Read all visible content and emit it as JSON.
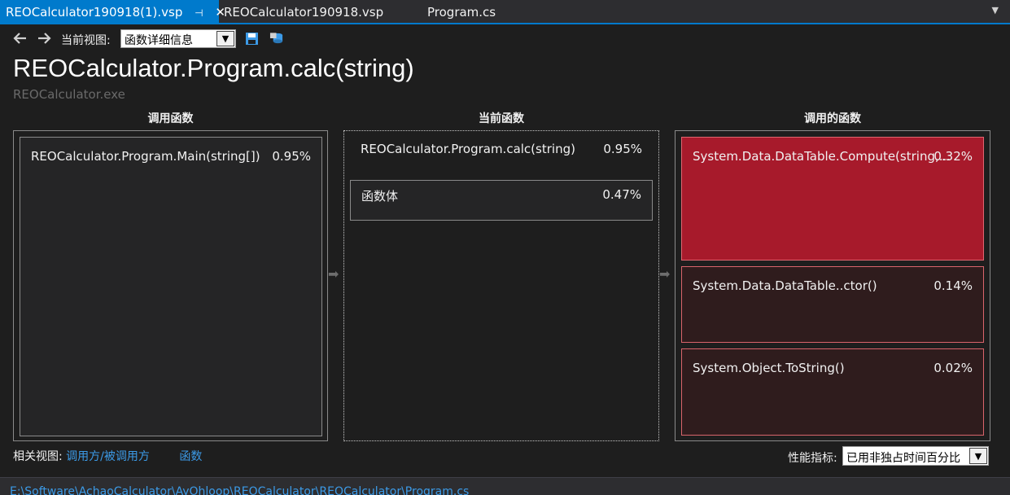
{
  "tabs": [
    {
      "label": "REOCalculator190918(1).vsp",
      "active": true
    },
    {
      "label": "REOCalculator190918.vsp",
      "active": false
    },
    {
      "label": "Program.cs",
      "active": false
    }
  ],
  "toolbar": {
    "view_label": "当前视图:",
    "view_value": "函数详细信息"
  },
  "page": {
    "title": "REOCalculator.Program.calc(string)",
    "module": "REOCalculator.exe"
  },
  "callers": {
    "header": "调用函数",
    "items": [
      {
        "name": "REOCalculator.Program.Main(string[])",
        "percent": "0.95%"
      }
    ]
  },
  "current": {
    "header": "当前函数",
    "name": "REOCalculator.Program.calc(string)",
    "percent": "0.95%",
    "body": {
      "name": "函数体",
      "percent": "0.47%"
    }
  },
  "callees": {
    "header": "调用的函数",
    "items": [
      {
        "name": "System.Data.DataTable.Compute(string,...",
        "percent": "0.32%"
      },
      {
        "name": "System.Data.DataTable..ctor()",
        "percent": "0.14%"
      },
      {
        "name": "System.Object.ToString()",
        "percent": "0.02%"
      }
    ]
  },
  "related": {
    "label": "相关视图:",
    "link1": "调用方/被调用方",
    "link2": "函数"
  },
  "metric": {
    "label": "性能指标:",
    "value": "已用非独占时间百分比"
  },
  "status": {
    "path": "E:\\Software\\AchaoCalculator\\AyOhloop\\REOCalculator\\REOCalculator\\Program.cs"
  },
  "colors": {
    "accent": "#007acc",
    "hot": "#a71a2b",
    "warm": "#2f1c1d",
    "link": "#3c9be8"
  }
}
